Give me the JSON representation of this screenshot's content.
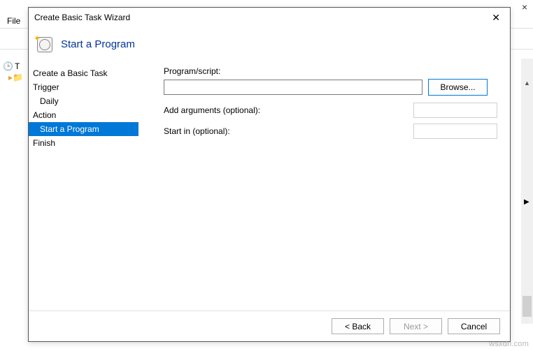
{
  "bg": {
    "menu_file": "File",
    "close_x": "×",
    "tree_label": "T"
  },
  "dialog": {
    "title": "Create Basic Task Wizard",
    "close_x": "✕",
    "heading": "Start a Program",
    "nav": {
      "create": "Create a Basic Task",
      "trigger": "Trigger",
      "daily": "Daily",
      "action": "Action",
      "start_program": "Start a Program",
      "finish": "Finish"
    },
    "form": {
      "program_label": "Program/script:",
      "program_value": "",
      "browse_label": "Browse...",
      "args_label": "Add arguments (optional):",
      "args_value": "",
      "startin_label": "Start in (optional):",
      "startin_value": ""
    },
    "footer": {
      "back": "< Back",
      "next": "Next >",
      "cancel": "Cancel"
    }
  },
  "watermark": "wsxdn.com"
}
